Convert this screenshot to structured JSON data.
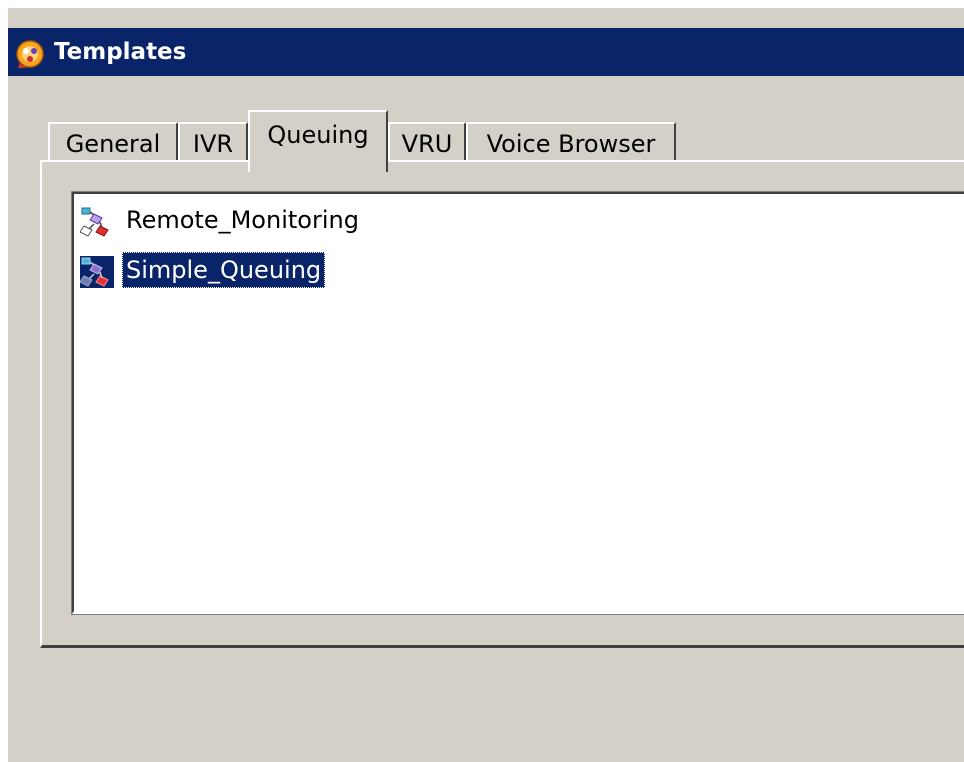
{
  "window": {
    "title": "Templates"
  },
  "tabs": [
    {
      "label": "General",
      "active": false
    },
    {
      "label": "IVR",
      "active": false
    },
    {
      "label": "Queuing",
      "active": true
    },
    {
      "label": "VRU",
      "active": false
    },
    {
      "label": "Voice Browser",
      "active": false
    }
  ],
  "list": {
    "items": [
      {
        "label": "Remote_Monitoring",
        "icon": "script-icon",
        "selected": false
      },
      {
        "label": "Simple_Queuing",
        "icon": "script-icon",
        "selected": true
      }
    ]
  },
  "colors": {
    "titlebar": "#0a246a",
    "face": "#d4d0c8",
    "selection": "#0a246a"
  }
}
